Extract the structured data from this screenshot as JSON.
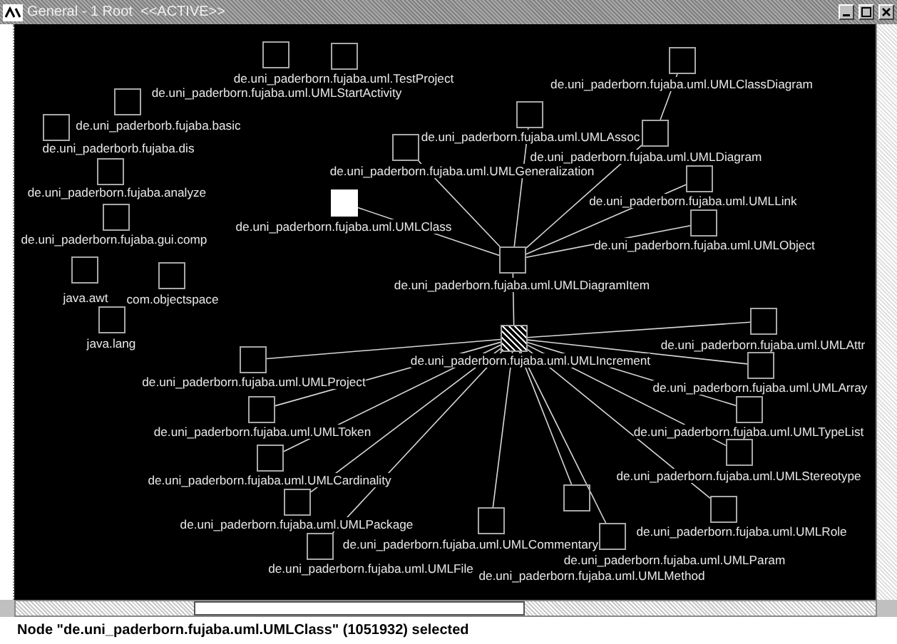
{
  "window": {
    "title": "General - 1 Root  <<ACTIVE>>"
  },
  "graph": {
    "nodes": [
      {
        "label": "de.uni_paderborn.fujaba.uml.TestProject",
        "selected": false,
        "marked": false
      },
      {
        "label": "de.uni_paderborn.fujaba.uml.UMLStartActivity",
        "selected": false,
        "marked": false
      },
      {
        "label": "de.uni_paderborb.fujaba.basic",
        "selected": false,
        "marked": false
      },
      {
        "label": "de.uni_paderborb.fujaba.dis",
        "selected": false,
        "marked": false
      },
      {
        "label": "de.uni_paderborn.fujaba.analyze",
        "selected": false,
        "marked": false
      },
      {
        "label": "de.uni_paderborn.fujaba.gui.comp",
        "selected": false,
        "marked": false
      },
      {
        "label": "java.awt",
        "selected": false,
        "marked": false
      },
      {
        "label": "com.objectspace",
        "selected": false,
        "marked": false
      },
      {
        "label": "java.lang",
        "selected": false,
        "marked": false
      },
      {
        "label": "de.uni_paderborn.fujaba.uml.UMLClass",
        "selected": true,
        "marked": false
      },
      {
        "label": "de.uni_paderborn.fujaba.uml.UMLGeneralization",
        "selected": false,
        "marked": false
      },
      {
        "label": "de.uni_paderborn.fujaba.uml.UMLAssoc",
        "selected": false,
        "marked": false
      },
      {
        "label": "de.uni_paderborn.fujaba.uml.UMLClassDiagram",
        "selected": false,
        "marked": false
      },
      {
        "label": "de.uni_paderborn.fujaba.uml.UMLDiagram",
        "selected": false,
        "marked": false
      },
      {
        "label": "de.uni_paderborn.fujaba.uml.UMLLink",
        "selected": false,
        "marked": false
      },
      {
        "label": "de.uni_paderborn.fujaba.uml.UMLObject",
        "selected": false,
        "marked": false
      },
      {
        "label": "de.uni_paderborn.fujaba.uml.UMLDiagramItem",
        "selected": false,
        "marked": false
      },
      {
        "label": "de.uni_paderborn.fujaba.uml.UMLIncrement",
        "selected": false,
        "marked": true
      },
      {
        "label": "de.uni_paderborn.fujaba.uml.UMLAttr",
        "selected": false,
        "marked": false
      },
      {
        "label": "de.uni_paderborn.fujaba.uml.UMLArray",
        "selected": false,
        "marked": false
      },
      {
        "label": "de.uni_paderborn.fujaba.uml.UMLTypeList",
        "selected": false,
        "marked": false
      },
      {
        "label": "de.uni_paderborn.fujaba.uml.UMLStereotype",
        "selected": false,
        "marked": false
      },
      {
        "label": "de.uni_paderborn.fujaba.uml.UMLRole",
        "selected": false,
        "marked": false
      },
      {
        "label": "de.uni_paderborn.fujaba.uml.UMLParam",
        "selected": false,
        "marked": false
      },
      {
        "label": "de.uni_paderborn.fujaba.uml.UMLMethod",
        "selected": false,
        "marked": false
      },
      {
        "label": "de.uni_paderborn.fujaba.uml.UMLCommentary",
        "selected": false,
        "marked": false
      },
      {
        "label": "de.uni_paderborn.fujaba.uml.UMLFile",
        "selected": false,
        "marked": false
      },
      {
        "label": "de.uni_paderborn.fujaba.uml.UMLProject",
        "selected": false,
        "marked": false
      },
      {
        "label": "de.uni_paderborn.fujaba.uml.UMLToken",
        "selected": false,
        "marked": false
      },
      {
        "label": "de.uni_paderborn.fujaba.uml.UMLCardinality",
        "selected": false,
        "marked": false
      },
      {
        "label": "de.uni_paderborn.fujaba.uml.UMLPackage",
        "selected": false,
        "marked": false
      }
    ]
  },
  "status_bar": {
    "message": "Node \"de.uni_paderborn.fujaba.uml.UMLClass\" (1051932) selected"
  }
}
